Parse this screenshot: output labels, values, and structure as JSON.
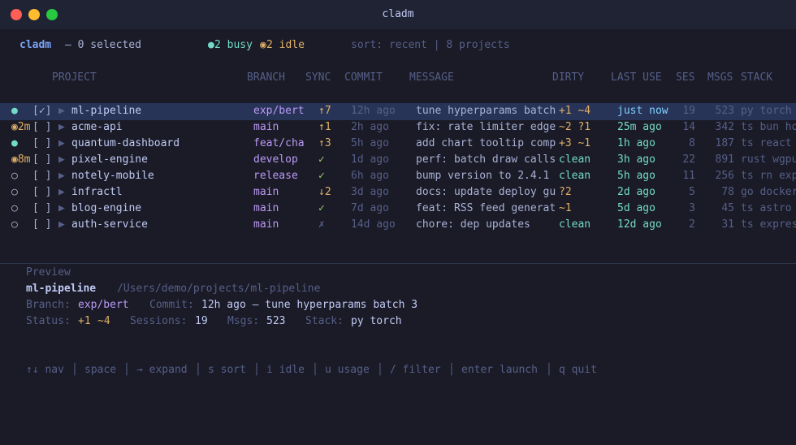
{
  "window": {
    "title": "cladm"
  },
  "status": {
    "app": "cladm",
    "selected": "— 0 selected",
    "busy_dot": "●",
    "busy": "2 busy",
    "idle_dot": "◉",
    "idle": "2 idle",
    "sort": "sort: recent | 8 projects"
  },
  "columns": {
    "project": "PROJECT",
    "branch": "BRANCH",
    "sync": "SYNC",
    "commit": "COMMIT",
    "message": "MESSAGE",
    "dirty": "DIRTY",
    "last_use": "LAST USE",
    "ses": "SES",
    "msgs": "MSGS",
    "stack": "STACK"
  },
  "rows": [
    {
      "status": "●",
      "status_color": "#73daca",
      "check": "[✓]",
      "arrow": "▶",
      "name": "ml-pipeline",
      "branch": "exp/bert",
      "sync": "↑7",
      "commit": "12h ago",
      "message": "tune hyperparams batch",
      "dirty": "+1 ~4",
      "dirty_color": "#e0af68",
      "last_use": "just now",
      "ses": "19",
      "msgs": "523",
      "stack": "py torch"
    },
    {
      "status": "◉2m",
      "status_color": "#e0af68",
      "check": "[ ]",
      "arrow": "▶",
      "name": "acme-api",
      "branch": "main",
      "sync": "↑1",
      "commit": "2h ago",
      "message": "fix: rate limiter edge",
      "dirty": "~2 ?1",
      "dirty_color": "#e0af68",
      "last_use": "25m ago",
      "ses": "14",
      "msgs": "342",
      "stack": "ts bun ho"
    },
    {
      "status": "●",
      "status_color": "#73daca",
      "check": "[ ]",
      "arrow": "▶",
      "name": "quantum-dashboard",
      "branch": "feat/cha",
      "sync": "↑3",
      "commit": "5h ago",
      "message": "add chart tooltip comp",
      "dirty": "+3 ~1",
      "dirty_color": "#e0af68",
      "last_use": "1h ago",
      "ses": "8",
      "msgs": "187",
      "stack": "ts react"
    },
    {
      "status": "◉8m",
      "status_color": "#e0af68",
      "check": "[ ]",
      "arrow": "▶",
      "name": "pixel-engine",
      "branch": "develop",
      "sync": "✓",
      "commit": "1d ago",
      "message": "perf: batch draw calls",
      "dirty": "clean",
      "dirty_color": "#73daca",
      "last_use": "3h ago",
      "ses": "22",
      "msgs": "891",
      "stack": "rust wgpu"
    },
    {
      "status": "○",
      "status_color": "#a9b1d6",
      "check": "[ ]",
      "arrow": "▶",
      "name": "notely-mobile",
      "branch": "release",
      "sync": "✓",
      "commit": "6h ago",
      "message": "bump version to 2.4.1",
      "dirty": "clean",
      "dirty_color": "#73daca",
      "last_use": "5h ago",
      "ses": "11",
      "msgs": "256",
      "stack": "ts rn exp"
    },
    {
      "status": "○",
      "status_color": "#a9b1d6",
      "check": "[ ]",
      "arrow": "▶",
      "name": "infractl",
      "branch": "main",
      "sync": "↓2",
      "commit": "3d ago",
      "message": "docs: update deploy gu",
      "dirty": "?2",
      "dirty_color": "#e0af68",
      "last_use": "2d ago",
      "ses": "5",
      "msgs": "78",
      "stack": "go docker"
    },
    {
      "status": "○",
      "status_color": "#a9b1d6",
      "check": "[ ]",
      "arrow": "▶",
      "name": "blog-engine",
      "branch": "main",
      "sync": "✓",
      "commit": "7d ago",
      "message": "feat: RSS feed generat",
      "dirty": "~1",
      "dirty_color": "#e0af68",
      "last_use": "5d ago",
      "ses": "3",
      "msgs": "45",
      "stack": "ts astro"
    },
    {
      "status": "○",
      "status_color": "#a9b1d6",
      "check": "[ ]",
      "arrow": "▶",
      "name": "auth-service",
      "branch": "main",
      "sync": "✗",
      "commit": "14d ago",
      "message": "chore: dep updates",
      "dirty": "clean",
      "dirty_color": "#73daca",
      "last_use": "12d ago",
      "ses": "2",
      "msgs": "31",
      "stack": "ts expres"
    }
  ],
  "preview": {
    "heading": "Preview",
    "name": "ml-pipeline",
    "path": "/Users/demo/projects/ml-pipeline",
    "branch_label": "Branch:",
    "branch": "exp/bert",
    "commit_label": "Commit:",
    "commit": "12h ago — tune hyperparams batch 3",
    "status_label": "Status:",
    "status_plus": "+1",
    "status_mod": "~4",
    "sessions_label": "Sessions:",
    "sessions": "19",
    "msgs_label": "Msgs:",
    "msgs": "523",
    "stack_label": "Stack:",
    "stack": "py torch"
  },
  "footer": {
    "nav": "↑↓ nav",
    "space": "space",
    "expand": "→ expand",
    "sort": "s sort",
    "idle": "i idle",
    "usage": "u usage",
    "filter": "/ filter",
    "launch": "enter launch",
    "quit": "q quit",
    "sep": "│"
  }
}
